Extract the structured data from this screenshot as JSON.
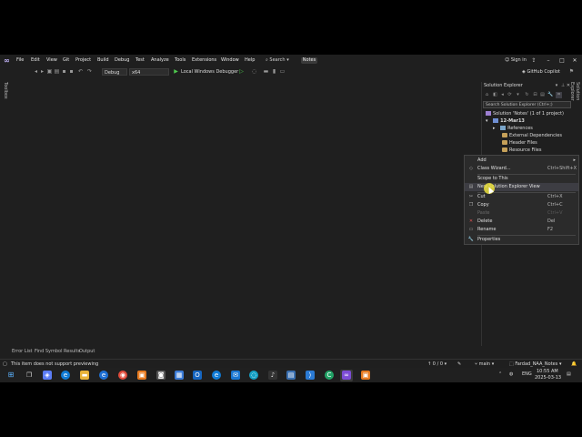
{
  "menubar": {
    "items": [
      "File",
      "Edit",
      "View",
      "Git",
      "Project",
      "Build",
      "Debug",
      "Test",
      "Analyze",
      "Tools",
      "Extensions",
      "Window",
      "Help"
    ],
    "search_label": "Search",
    "solution_badge": "Notes",
    "signin_label": "Sign in"
  },
  "toolbar": {
    "config": "Debug",
    "platform": "x64",
    "run_label": "Local Windows Debugger",
    "copilot_label": "GitHub Copilot"
  },
  "toolbox_tab": "Toolbox",
  "solution_explorer": {
    "title": "Solution Explorer",
    "side_tab": "Solution Explorer",
    "search_placeholder": "Search Solution Explorer (Ctrl+;)",
    "tree": [
      {
        "label": "Solution 'Notes' (1 of 1 project)",
        "icon": "solution-icon",
        "indent": 0
      },
      {
        "label": "12-Mar13",
        "icon": "project-icon",
        "indent": 1
      },
      {
        "label": "References",
        "icon": "references-icon",
        "indent": 2
      },
      {
        "label": "External Dependencies",
        "icon": "folder-icon",
        "indent": 2
      },
      {
        "label": "Header Files",
        "icon": "folder-icon",
        "indent": 2
      },
      {
        "label": "Resource Files",
        "icon": "folder-icon",
        "indent": 2
      }
    ]
  },
  "context_menu": {
    "items": [
      {
        "label": "Add",
        "shortcut": "",
        "icon": "",
        "submenu": true
      },
      {
        "label": "Class Wizard...",
        "shortcut": "Ctrl+Shift+X",
        "icon": "class-wizard-icon"
      },
      {
        "label": "Scope to This",
        "shortcut": "",
        "icon": ""
      },
      {
        "label": "New Solution Explorer View",
        "shortcut": "",
        "icon": "new-view-icon"
      },
      {
        "label": "Cut",
        "shortcut": "Ctrl+X",
        "icon": "cut-icon"
      },
      {
        "label": "Copy",
        "shortcut": "Ctrl+C",
        "icon": "copy-icon"
      },
      {
        "label": "Paste",
        "shortcut": "Ctrl+V",
        "icon": "",
        "disabled": true
      },
      {
        "label": "Delete",
        "shortcut": "Del",
        "icon": "delete-icon"
      },
      {
        "label": "Rename",
        "shortcut": "F2",
        "icon": "rename-icon"
      },
      {
        "label": "Properties",
        "shortcut": "",
        "icon": "wrench-icon"
      }
    ]
  },
  "bottom_tabs": [
    "Error List",
    "Find Symbol Results",
    "Output"
  ],
  "statusbar": {
    "message": "This item does not support previewing",
    "errors": "0 / 0",
    "branch": "main",
    "repo": "Fardad_NAA_Notes"
  },
  "taskbar": {
    "lang": "ENG",
    "time": "10:55 AM",
    "date": "2025-03-13"
  },
  "colors": {
    "accent": "#c7b9ff",
    "background": "#1f1f1f",
    "context_menu": "#2b2b2b",
    "cursor_highlight": "#ebe13c"
  }
}
